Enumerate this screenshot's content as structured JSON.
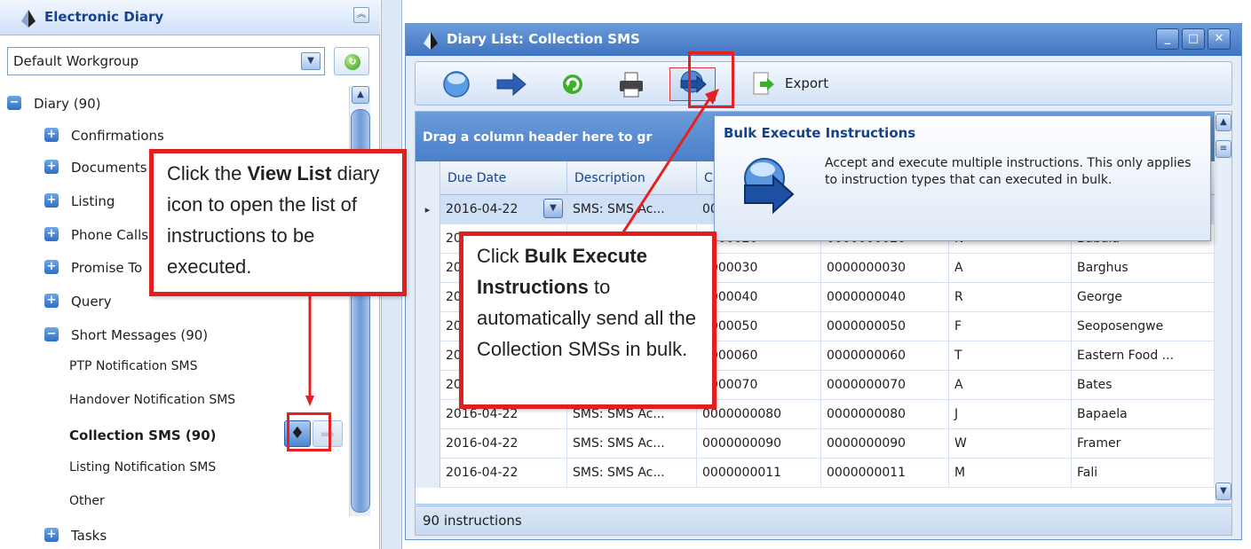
{
  "left_panel": {
    "title": "Electronic Diary",
    "workgroup": "Default Workgroup",
    "tree": {
      "root": "Diary (90)",
      "items": [
        "Confirmations",
        "Documents",
        "Listing",
        "Phone Calls",
        "Promise To",
        "Query"
      ],
      "short_messages": "Short Messages (90)",
      "sub_items": [
        "PTP Notification SMS",
        "Handover Notification SMS",
        "Collection SMS (90)",
        "Listing Notification SMS",
        "Other"
      ],
      "tasks": "Tasks"
    }
  },
  "window": {
    "title": "Diary List: Collection SMS",
    "toolbar": {
      "export_label": "Export"
    },
    "group_panel_text": "Drag a column header here to gr",
    "columns": [
      "Due Date",
      "Description",
      "C"
    ],
    "rows": [
      [
        "2016-04-22",
        "SMS: SMS Ac...",
        "00",
        "",
        "",
        ""
      ],
      [
        "20",
        "",
        "0000020",
        "0000000020",
        "N",
        "Babala"
      ],
      [
        "20",
        "",
        "0000030",
        "0000000030",
        "A",
        "Barghus"
      ],
      [
        "20",
        "",
        "0000040",
        "0000000040",
        "R",
        " George"
      ],
      [
        "20",
        "",
        "0000050",
        "0000000050",
        "F",
        " Seoposengwe"
      ],
      [
        "20",
        "",
        "0000060",
        "0000000060",
        "T",
        "Eastern Food ..."
      ],
      [
        "20",
        "",
        "0000070",
        "0000000070",
        "A",
        "Bates"
      ],
      [
        "2016-04-22",
        "SMS: SMS Ac...",
        "0000000080",
        "0000000080",
        "J",
        "Bapaela"
      ],
      [
        "2016-04-22",
        "SMS: SMS Ac...",
        "0000000090",
        "0000000090",
        "W",
        " Framer"
      ],
      [
        "2016-04-22",
        "SMS: SMS Ac...",
        "0000000011",
        "0000000011",
        "M",
        "Fali"
      ]
    ],
    "status": "90 instructions"
  },
  "tooltip": {
    "title": "Bulk Execute Instructions",
    "body": "Accept and execute multiple instructions. This only applies to instruction types that can executed in bulk."
  },
  "callouts": {
    "view_list": {
      "pre": "Click the ",
      "bold": "View List",
      "post": "diary icon to open the list of instructions to be executed."
    },
    "bulk_execute": {
      "pre": "Click ",
      "bold": "Bulk Execute Instructions",
      "post": " to automatically send all the Collection SMSs in bulk."
    }
  },
  "colors": {
    "annotation_red": "#e02020",
    "title_blue": "#15428b",
    "header_blue": "#4a80c9"
  },
  "icons": [
    "diary-logo-icon",
    "refresh-icon",
    "expand-icon",
    "circle-nav-icon",
    "arrow-right-icon",
    "refresh-green-icon",
    "printer-icon",
    "bulk-execute-icon",
    "export-icon",
    "minimize-icon",
    "maximize-icon",
    "close-icon"
  ]
}
